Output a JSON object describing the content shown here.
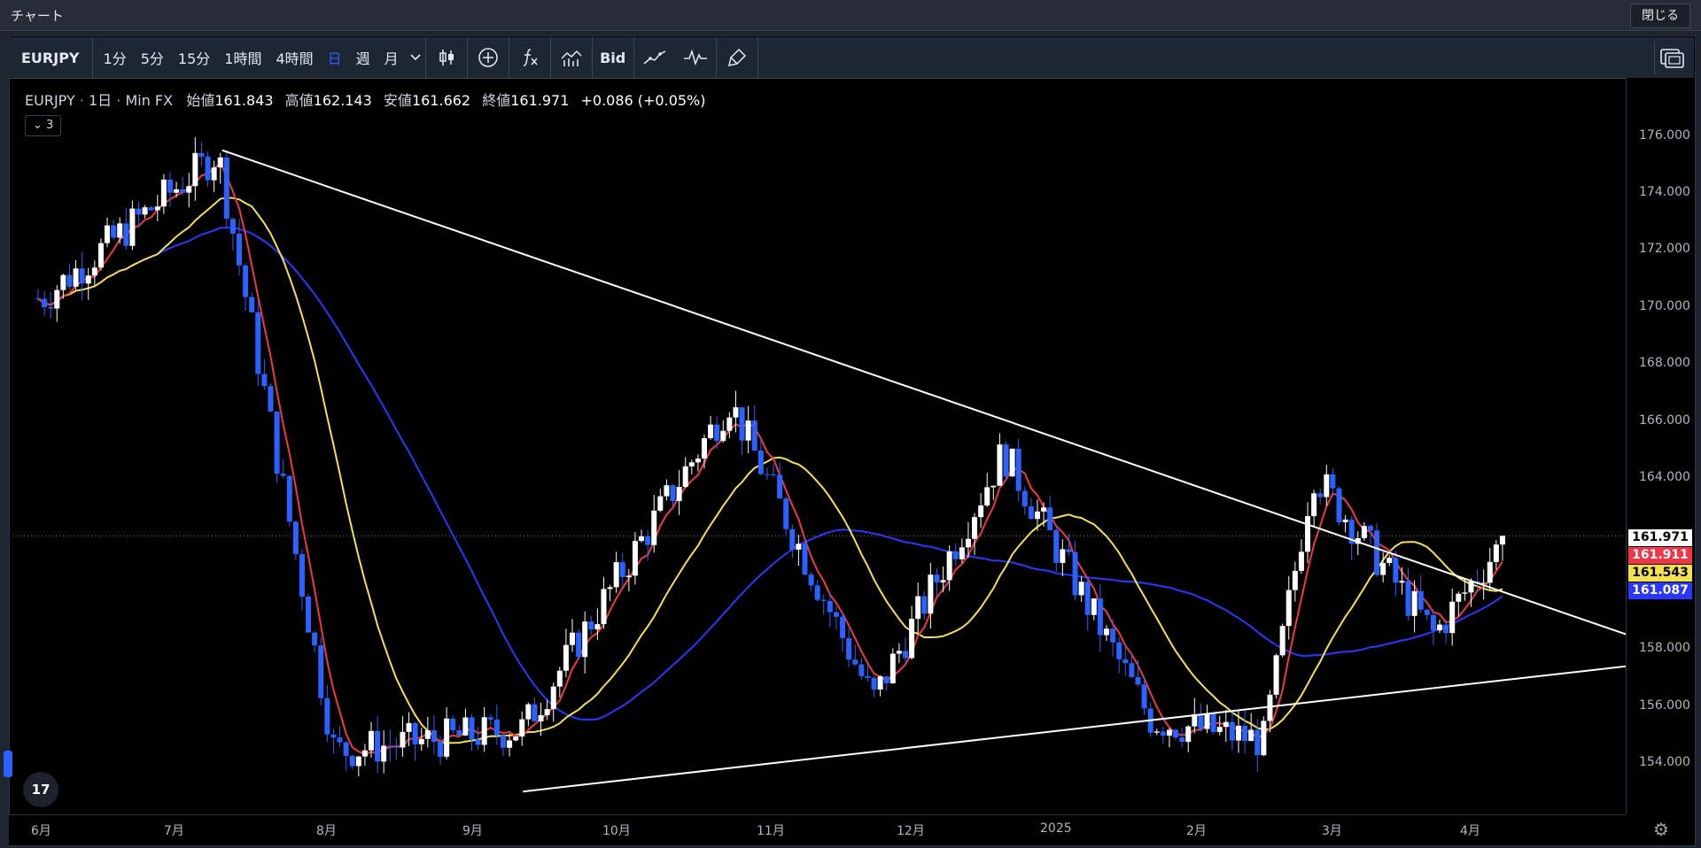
{
  "window": {
    "title": "チャート",
    "close_label": "閉じる"
  },
  "toolbar": {
    "symbol": "EURJPY",
    "intervals": [
      {
        "label": "1分",
        "active": false
      },
      {
        "label": "5分",
        "active": false
      },
      {
        "label": "15分",
        "active": false
      },
      {
        "label": "1時間",
        "active": false
      },
      {
        "label": "4時間",
        "active": false
      },
      {
        "label": "日",
        "active": true
      },
      {
        "label": "週",
        "active": false
      },
      {
        "label": "月",
        "active": false
      }
    ],
    "interval_dropdown_icon": "chevron-down-icon",
    "icons": [
      "candlestick-icon",
      "plus-circle-icon",
      "fx-indicator-icon",
      "bar-compare-icon"
    ],
    "bid_label": "Bid",
    "icons_after_bid": [
      "trendline-icon",
      "pulse-icon",
      "brush-icon"
    ],
    "layout_icon": "layout-icon"
  },
  "legend": {
    "symbol": "EURJPY",
    "interval": "1日",
    "source": "Min FX",
    "open_label": "始値",
    "open": "161.843",
    "high_label": "高値",
    "high": "162.143",
    "low_label": "安値",
    "low": "161.662",
    "close_label": "終値",
    "close": "161.971",
    "change": "+0.086 (+0.05%)",
    "indicator_toggle": "3"
  },
  "price_axis": [
    "176.000",
    "174.000",
    "172.000",
    "170.000",
    "168.000",
    "166.000",
    "164.000",
    "158.000",
    "156.000",
    "154.000"
  ],
  "price_badges": [
    {
      "value": "161.971",
      "bg": "#ffffff",
      "fg": "#000000"
    },
    {
      "value": "161.911",
      "bg": "#f23645",
      "fg": "#ffffff"
    },
    {
      "value": "161.543",
      "bg": "#f5e04e",
      "fg": "#000000"
    },
    {
      "value": "161.087",
      "bg": "#2b36ff",
      "fg": "#ffffff"
    }
  ],
  "time_axis": [
    "6月",
    "7月",
    "8月",
    "9月",
    "10月",
    "11月",
    "12月",
    "2025",
    "2月",
    "3月",
    "4月"
  ],
  "colors": {
    "up": "#ffffff",
    "down": "#2962ff",
    "ma_fast": "#f23645",
    "ma_mid": "#f5e04e",
    "ma_slow": "#2b36ff"
  },
  "chart_data": {
    "type": "candlestick",
    "symbol": "EURJPY",
    "interval": "1日",
    "last_close": 161.971,
    "moving_averages": [
      {
        "color": "red",
        "last": 161.911
      },
      {
        "color": "yellow",
        "last": 161.543
      },
      {
        "color": "blue",
        "last": 161.087
      }
    ],
    "swing_points": [
      {
        "x": "2024-06",
        "y": 170.3
      },
      {
        "x": "2024-07-10",
        "y": 175.4
      },
      {
        "x": "2024-08-05",
        "y": 154.4
      },
      {
        "x": "2024-09-16",
        "y": 155.2
      },
      {
        "x": "2024-11-01",
        "y": 166.7
      },
      {
        "x": "2024-12-03",
        "y": 156.2
      },
      {
        "x": "2025-01-01",
        "y": 164.9
      },
      {
        "x": "2025-02-03",
        "y": 155.5
      },
      {
        "x": "2025-02-28",
        "y": 154.8
      },
      {
        "x": "2025-03-11",
        "y": 164.2
      },
      {
        "x": "2025-04-07",
        "y": 158.5
      },
      {
        "x": "2025-04-23",
        "y": 161.971
      }
    ],
    "trendlines": [
      {
        "from": {
          "x": "2024-07-11",
          "y": 175.5
        },
        "to": {
          "x": "2025-05-20",
          "y": 158.5
        }
      },
      {
        "from": {
          "x": "2024-09-16",
          "y": 153.0
        },
        "to": {
          "x": "2025-05-20",
          "y": 157.4
        }
      }
    ],
    "ylim": [
      152.5,
      176.8
    ]
  }
}
